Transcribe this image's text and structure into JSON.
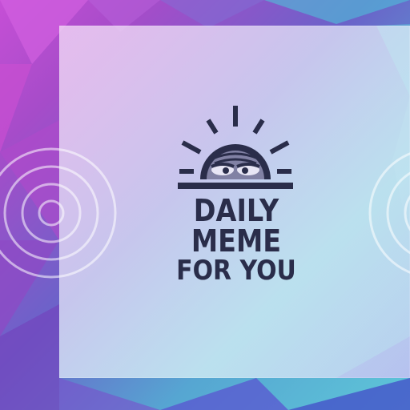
{
  "brand": {
    "line1": "DAILY",
    "line2": "MEME",
    "line3": "FOR YOU",
    "ink_color": "#2a2d4a"
  },
  "background": {
    "colors": [
      "#c64fd6",
      "#6a63c9",
      "#5ec6d8",
      "#4f56c8"
    ]
  }
}
